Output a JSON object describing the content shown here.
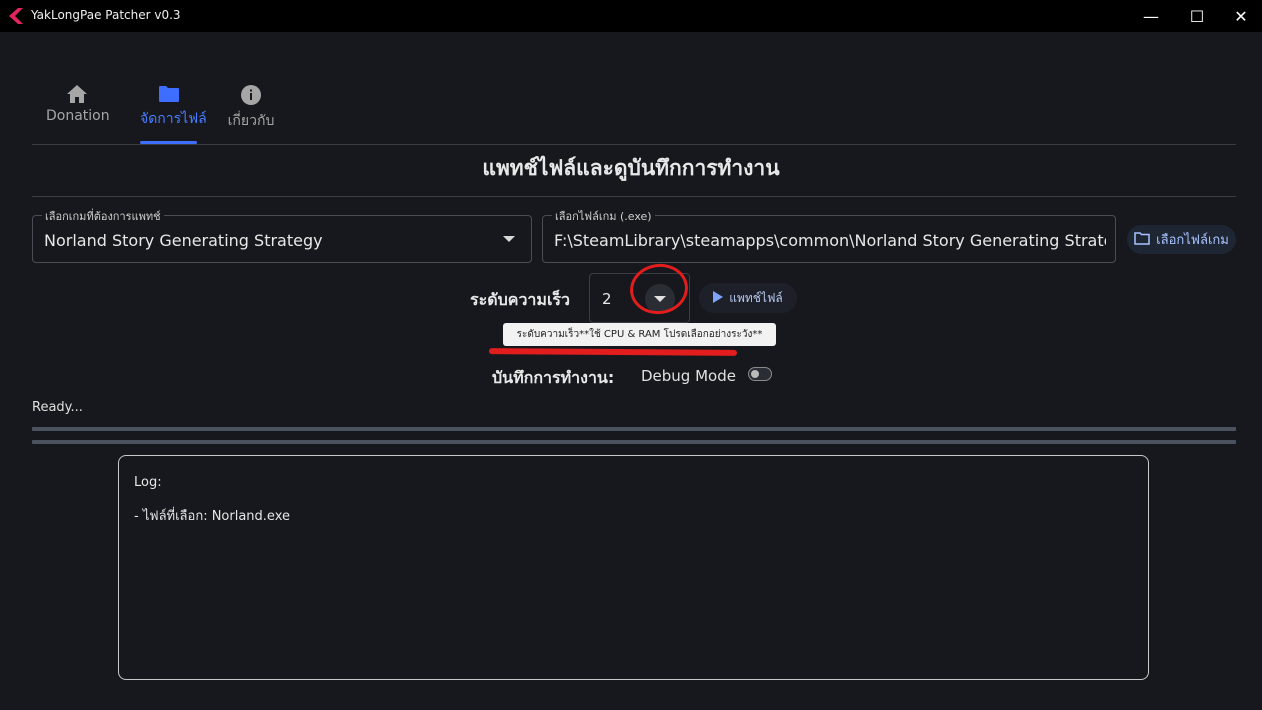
{
  "window": {
    "title": "YakLongPae Patcher v0.3",
    "controls": {
      "minimize": "—",
      "maximize": "☐",
      "close": "✕"
    }
  },
  "tabs": [
    {
      "label": "Donation",
      "icon": "home-icon"
    },
    {
      "label": "จัดการไฟล์",
      "icon": "folder-icon",
      "active": true
    },
    {
      "label": "เกี่ยวกับ",
      "icon": "info-icon"
    }
  ],
  "main": {
    "title": "แพทช์ไฟล์และดูบันทึกการทำงาน",
    "game_select": {
      "label": "เลือกเกมที่ต้องการแพทช์",
      "value": "Norland Story Generating Strategy"
    },
    "path_field": {
      "label": "เลือกไฟล์เกม (.exe)",
      "value": "F:\\SteamLibrary\\steamapps\\common\\Norland Story Generating Strategy\\"
    },
    "choose_file_button": "เลือกไฟล์เกม",
    "speed": {
      "label": "ระดับความเร็ว",
      "value": "2"
    },
    "patch_button": "แพทช์ไฟล์",
    "tooltip": "ระดับความเร็ว**ใช้ CPU & RAM โปรดเลือกอย่างระวัง**",
    "log_label": "บันทึกการทำงาน:",
    "debug_mode": {
      "label": "Debug Mode",
      "enabled": false
    },
    "status": "Ready..."
  },
  "log": {
    "title": "Log:",
    "lines": [
      "- ไฟล์ที่เลือก: Norland.exe"
    ]
  },
  "colors": {
    "background": "#16181d",
    "accent": "#3d6eff",
    "annotation_red": "#e11d1d"
  }
}
